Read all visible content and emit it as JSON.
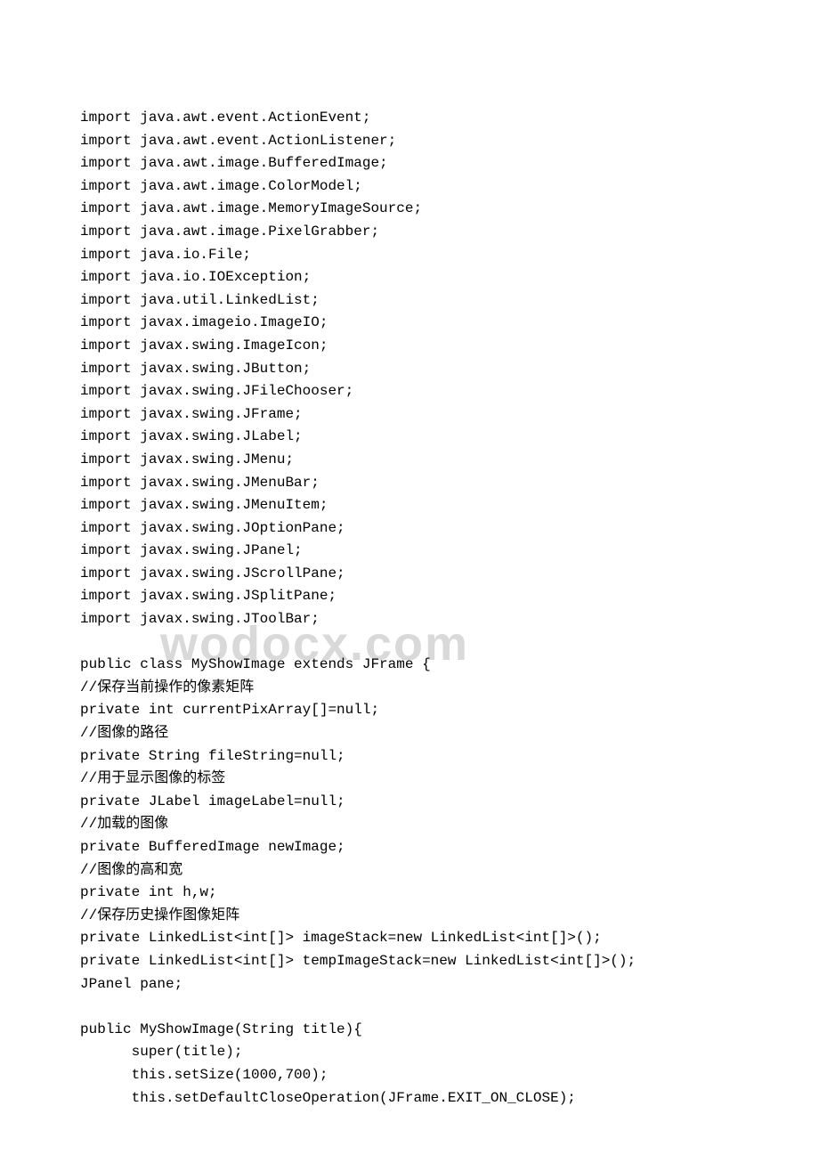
{
  "watermark": "wodocx.com",
  "code": {
    "imports": [
      "import java.awt.event.ActionEvent;",
      "import java.awt.event.ActionListener;",
      "import java.awt.image.BufferedImage;",
      "import java.awt.image.ColorModel;",
      "import java.awt.image.MemoryImageSource;",
      "import java.awt.image.PixelGrabber;",
      "import java.io.File;",
      "import java.io.IOException;",
      "import java.util.LinkedList;",
      "import javax.imageio.ImageIO;",
      "import javax.swing.ImageIcon;",
      "import javax.swing.JButton;",
      "import javax.swing.JFileChooser;",
      "import javax.swing.JFrame;",
      "import javax.swing.JLabel;",
      "import javax.swing.JMenu;",
      "import javax.swing.JMenuBar;",
      "import javax.swing.JMenuItem;",
      "import javax.swing.JOptionPane;",
      "import javax.swing.JPanel;",
      "import javax.swing.JScrollPane;",
      "import javax.swing.JSplitPane;",
      "import javax.swing.JToolBar;"
    ],
    "class_decl": "public class MyShowImage extends JFrame {",
    "fields": [
      "//保存当前操作的像素矩阵",
      "private int currentPixArray[]=null;",
      "//图像的路径",
      "private String fileString=null;",
      "//用于显示图像的标签",
      "private JLabel imageLabel=null;",
      "//加载的图像",
      "private BufferedImage newImage;",
      "//图像的高和宽",
      "private int h,w;",
      "//保存历史操作图像矩阵",
      "private LinkedList<int[]> imageStack=new LinkedList<int[]>();",
      "private LinkedList<int[]> tempImageStack=new LinkedList<int[]>();",
      "JPanel pane;"
    ],
    "constructor": [
      "public MyShowImage(String title){",
      "      super(title);",
      "      this.setSize(1000,700);",
      "      this.setDefaultCloseOperation(JFrame.EXIT_ON_CLOSE);"
    ]
  }
}
